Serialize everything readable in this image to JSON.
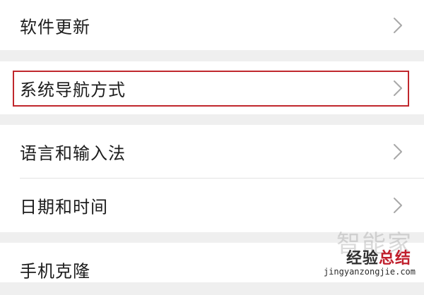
{
  "settings": {
    "items": [
      {
        "label": "软件更新",
        "icon": "chevron-right-icon"
      },
      {
        "label": "系统导航方式",
        "icon": "chevron-right-icon",
        "highlighted": true
      },
      {
        "label": "语言和输入法",
        "icon": "chevron-right-icon"
      },
      {
        "label": "日期和时间",
        "icon": "chevron-right-icon"
      },
      {
        "label": "手机克隆"
      }
    ]
  },
  "colors": {
    "background": "#efefef",
    "card": "#ffffff",
    "highlight": "#c0272d",
    "chevron": "#a8a8a8"
  },
  "watermark": {
    "logo": "智能家",
    "name_part1": "经验",
    "name_part2": "总结",
    "url": "jingyanzongjie.com"
  }
}
